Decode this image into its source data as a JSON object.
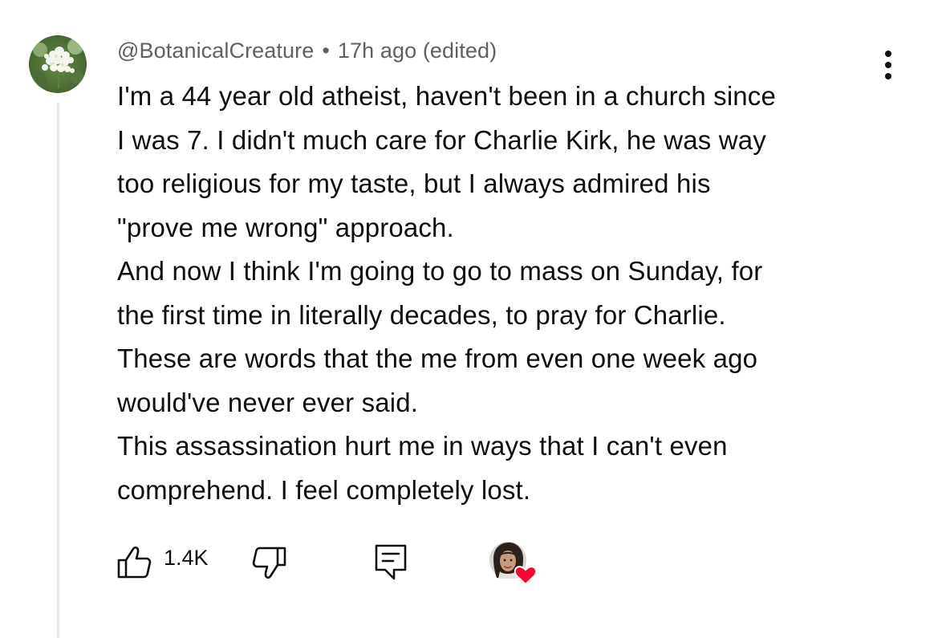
{
  "comment": {
    "author": "@BotanicalCreature",
    "separator": "•",
    "timestamp": "17h ago",
    "edited": "(edited)",
    "lines": [
      "I'm a 44 year old atheist, haven't been in a church since",
      "I was 7. I didn't much care for Charlie Kirk, he was way",
      "too religious for my taste, but I always admired his",
      "\"prove me wrong\" approach.",
      "And now I think I'm going to go to mass on Sunday, for",
      "the first time in literally decades, to pray for Charlie.",
      "These are words that the me from even one week ago",
      "would've never ever said.",
      "This assassination hurt me in ways that I can't even",
      "comprehend. I feel completely lost."
    ]
  },
  "actions": {
    "like_count": "1.4K",
    "like_icon": "thumbs-up-icon",
    "dislike_icon": "thumbs-down-icon",
    "reply_icon": "reply-icon",
    "more_icon": "more-vertical-icon"
  },
  "colors": {
    "text": "#0f0f0f",
    "meta": "#606060",
    "heart": "#ff0033",
    "thread_line": "#e6e6e6"
  }
}
